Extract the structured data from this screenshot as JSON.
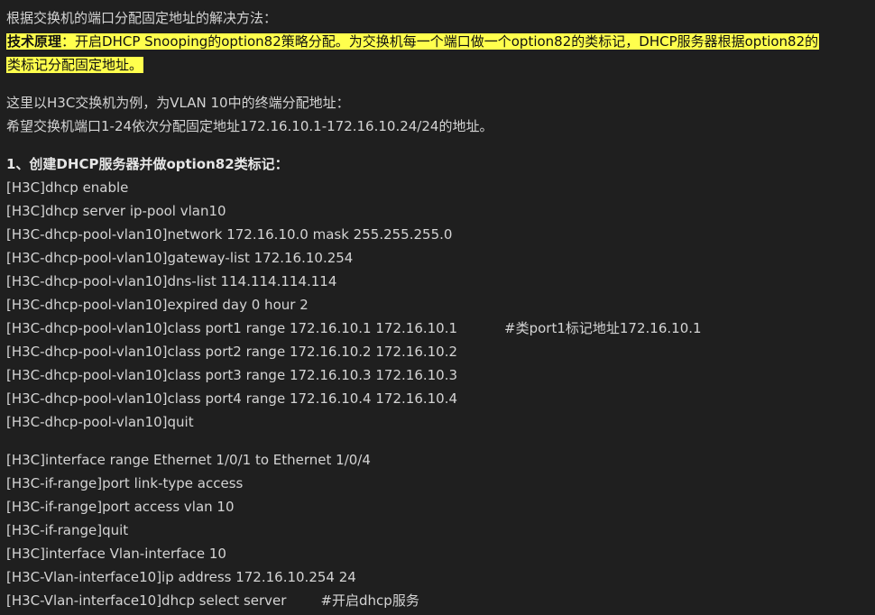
{
  "intro": "根据交换机的端口分配固定地址的解决方法：",
  "principle": {
    "label": "技术原理",
    "line1": "：开启DHCP Snooping的option82策略分配。为交换机每一个端口做一个option82的类标记，DHCP服务器根据option82的",
    "line2": "类标记分配固定地址。"
  },
  "example_line1": "这里以H3C交换机为例，为VLAN 10中的终端分配地址：",
  "example_line2": "希望交换机端口1-24依次分配固定地址172.16.10.1-172.16.10.24/24的地址。",
  "section1_title": "1、创建DHCP服务器并做option82类标记：",
  "commands_block1": [
    "[H3C]dhcp enable",
    "[H3C]dhcp server ip-pool vlan10",
    "[H3C-dhcp-pool-vlan10]network 172.16.10.0 mask 255.255.255.0",
    "[H3C-dhcp-pool-vlan10]gateway-list 172.16.10.254",
    "[H3C-dhcp-pool-vlan10]dns-list 114.114.114.114",
    "[H3C-dhcp-pool-vlan10]expired day 0 hour 2"
  ],
  "class_port1": {
    "cmd": "[H3C-dhcp-pool-vlan10]class port1 range 172.16.10.1 172.16.10.1",
    "comment": "#类port1标记地址172.16.10.1"
  },
  "commands_block2": [
    "[H3C-dhcp-pool-vlan10]class port2 range 172.16.10.2 172.16.10.2",
    "[H3C-dhcp-pool-vlan10]class port3 range 172.16.10.3 172.16.10.3",
    "[H3C-dhcp-pool-vlan10]class port4 range 172.16.10.4 172.16.10.4",
    "[H3C-dhcp-pool-vlan10]quit"
  ],
  "commands_block3": [
    "[H3C]interface range Ethernet 1/0/1 to Ethernet 1/0/4",
    "[H3C-if-range]port link-type access",
    "[H3C-if-range]port access vlan 10",
    "[H3C-if-range]quit",
    "[H3C]interface Vlan-interface 10",
    "[H3C-Vlan-interface10]ip address 172.16.10.254 24"
  ],
  "dhcp_select": {
    "cmd": "[H3C-Vlan-interface10]dhcp select server",
    "comment": "#开启dhcp服务"
  }
}
